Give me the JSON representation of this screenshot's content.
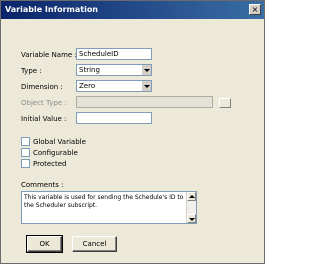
{
  "window": {
    "title": "Variable Information",
    "close_glyph": "×"
  },
  "form": {
    "variable_name": {
      "label": "Variable Name :",
      "value": "ScheduleID"
    },
    "type": {
      "label": "Type :",
      "value": "String"
    },
    "dimension": {
      "label": "Dimension :",
      "value": "Zero"
    },
    "object_type": {
      "label": "Object Type :",
      "value": ""
    },
    "initial_value": {
      "label": "Initial Value :",
      "value": ""
    }
  },
  "checkboxes": [
    {
      "label": "Global Variable",
      "checked": false
    },
    {
      "label": "Configurable",
      "checked": false
    },
    {
      "label": "Protected",
      "checked": false
    }
  ],
  "comments": {
    "label": "Comments :",
    "value": "This variable is used for sending the Schedule's ID to the Scheduler subscript."
  },
  "buttons": {
    "ok": "OK",
    "cancel": "Cancel"
  },
  "icons": {
    "dropdown": "chevron-down-icon",
    "close": "close-icon"
  }
}
